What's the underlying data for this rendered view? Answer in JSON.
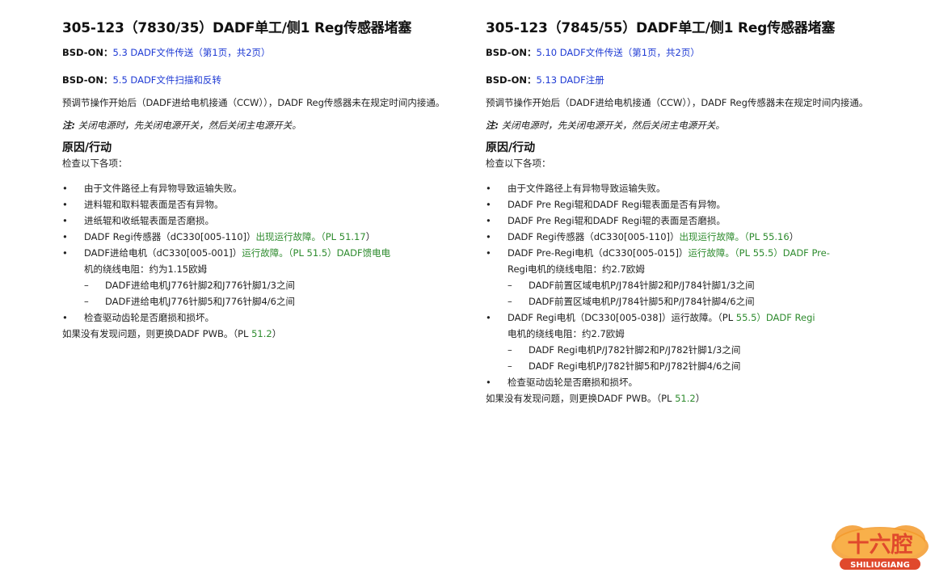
{
  "left": {
    "title": "305-123（7830/35）DADF单工/侧1 Reg传感器堵塞",
    "bsd1_label": "BSD-ON：",
    "bsd1_link": "5.3 DADF文件传送（第1页，共2页）",
    "bsd2_label": "BSD-ON：",
    "bsd2_link": "5.5 DADF文件扫描和反转",
    "desc": "预调节操作开始后（DADF进给电机接通（CCW）），DADF Reg传感器未在规定时间内接通。",
    "note_label": "注:",
    "note_text": " 关闭电源时，先关闭电源开关，然后关闭主电源开关。",
    "heading": "原因/行动",
    "intro": "检查以下各项：",
    "items": {
      "i1": "由于文件路径上有异物导致运输失败。",
      "i2": "进料辊和取料辊表面是否有异物。",
      "i3": "进纸辊和收纸辊表面是否磨损。",
      "i4a": "DADF Regi传感器（dC330[005-110]）",
      "i4b": "出现运行故障。（PL ",
      "i4c": "51.17",
      "i4d": "）",
      "i5a": "DADF进给电机（dC330[005-001]）",
      "i5b": "运行故障。（PL ",
      "i5c": "51.5）DADF馈电电",
      "i5cont": "机的绕线电阻：约为1.15欧姆",
      "s1": "DADF进给电机J776针脚2和J776针脚1/3之间",
      "s2": "DADF进给电机J776针脚5和J776针脚4/6之间",
      "i6": "检查驱动齿轮是否磨损和损坏。"
    },
    "final_a": "如果没有发现问题，则更换DADF PWB。（PL ",
    "final_b": "51.2",
    "final_c": "）"
  },
  "right": {
    "title": "305-123（7845/55）DADF单工/侧1 Reg传感器堵塞",
    "bsd1_label": "BSD-ON：",
    "bsd1_link": "5.10 DADF文件传送（第1页，共2页）",
    "bsd2_label": "BSD-ON：",
    "bsd2_link": "5.13 DADF注册",
    "desc": "预调节操作开始后（DADF进给电机接通（CCW）），DADF Reg传感器未在规定时间内接通。",
    "note_label": "注:",
    "note_text": " 关闭电源时，先关闭电源开关，然后关闭主电源开关。",
    "heading": "原因/行动",
    "intro": "检查以下各项：",
    "items": {
      "i1": "由于文件路径上有异物导致运输失败。",
      "i2": "DADF Pre Regi辊和DADF Regi辊表面是否有异物。",
      "i3": "DADF Pre Regi辊和DADF Regi辊的表面是否磨损。",
      "i4a": "DADF Regi传感器（dC330[005-110]）",
      "i4b": "出现运行故障。（PL ",
      "i4c": "55.16",
      "i4d": "）",
      "i5a": "DADF Pre-Regi电机（dC330[005-015]）",
      "i5b": "运行故障。（PL ",
      "i5c": "55.5）DADF Pre-",
      "i5cont": "Regi电机的绕线电阻：约2.7欧姆",
      "s1": "DADF前置区域电机P/J784针脚2和P/J784针脚1/3之间",
      "s2": "DADF前置区域电机P/J784针脚5和P/J784针脚4/6之间",
      "i6a": "DADF Regi电机（DC330[005-038]）运行故障。（PL ",
      "i6b": "55.5）DADF Regi",
      "i6cont": "电机的绕线电阻：约2.7欧姆",
      "s3": "DADF Regi电机P/J782针脚2和P/J782针脚1/3之间",
      "s4": "DADF Regi电机P/J782针脚5和P/J782针脚4/6之间",
      "i7": "检查驱动齿轮是否磨损和损坏。"
    },
    "final_a": "如果没有发现问题，则更换DADF PWB。（PL ",
    "final_b": "51.2",
    "final_c": "）"
  },
  "bullet": "•",
  "dash": "–",
  "logo": {
    "cn": "十六腔",
    "en": "SHILIUGIANG",
    "color_red": "#e0492c",
    "color_orange": "#f39a2b"
  }
}
